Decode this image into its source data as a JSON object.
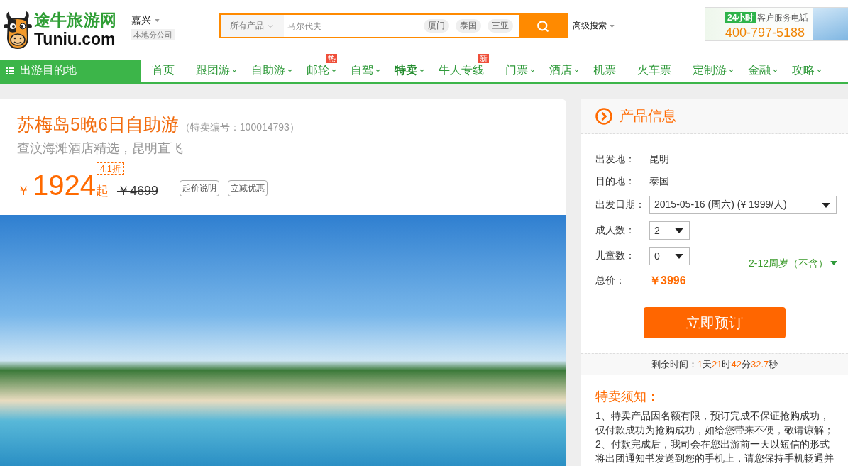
{
  "header": {
    "logo": {
      "title": "途牛旅游网",
      "domain": "Tuniu.com"
    },
    "city": {
      "name": "嘉兴",
      "badge": "本地分公司"
    },
    "search": {
      "category": "所有产品",
      "placeholder": "马尔代夫",
      "tags": [
        "厦门",
        "泰国",
        "三亚"
      ]
    },
    "advanced_search": "高级搜索",
    "hotline": {
      "badge": "24小时",
      "label": "客户服务电话",
      "number": "400-797-5188"
    }
  },
  "nav": {
    "destinations": "出游目的地",
    "items": [
      {
        "label": "首页",
        "dropdown": false,
        "selected": false
      },
      {
        "label": "跟团游",
        "dropdown": true,
        "selected": false
      },
      {
        "label": "自助游",
        "dropdown": true,
        "selected": false
      },
      {
        "label": "邮轮",
        "dropdown": true,
        "selected": false,
        "badge": "热"
      },
      {
        "label": "自驾",
        "dropdown": true,
        "selected": false
      },
      {
        "label": "特卖",
        "dropdown": true,
        "selected": true
      },
      {
        "label": "牛人专线",
        "dropdown": false,
        "selected": false,
        "badge": "新"
      },
      {
        "label": "门票",
        "dropdown": true,
        "selected": false
      },
      {
        "label": "酒店",
        "dropdown": true,
        "selected": false
      },
      {
        "label": "机票",
        "dropdown": false,
        "selected": false
      },
      {
        "label": "火车票",
        "dropdown": false,
        "selected": false
      },
      {
        "label": "定制游",
        "dropdown": true,
        "selected": false
      },
      {
        "label": "金融",
        "dropdown": true,
        "selected": false
      },
      {
        "label": "攻略",
        "dropdown": true,
        "selected": false
      }
    ]
  },
  "product": {
    "title": "苏梅岛5晚6日自助游",
    "code": "（特卖编号：100014793）",
    "subtitle": "查汶海滩酒店精选，昆明直飞",
    "price": {
      "currency": "￥",
      "amount": "1924",
      "suffix": "起",
      "discount": "4.1折",
      "original": "￥4699"
    },
    "buttons": [
      "起价说明",
      "立减优惠"
    ]
  },
  "info_panel": {
    "title": "产品信息",
    "fields": [
      {
        "kind": "text",
        "label": "出发地：",
        "value": "昆明"
      },
      {
        "kind": "text",
        "label": "目的地：",
        "value": "泰国"
      },
      {
        "kind": "date",
        "label": "出发日期：",
        "value": "2015-05-16 (周六) (¥ 1999/人)"
      },
      {
        "kind": "count",
        "label": "成人数：",
        "value": "2"
      },
      {
        "kind": "count",
        "label": "儿童数：",
        "value": "0",
        "note": "2-12周岁（不含）"
      },
      {
        "kind": "price",
        "label": "总价：",
        "value": "￥3996"
      }
    ],
    "book_button": "立即预订",
    "countdown": {
      "label": "剩余时间：",
      "parts": [
        {
          "value": "1",
          "unit": "天"
        },
        {
          "value": "21",
          "unit": "时"
        },
        {
          "value": "42",
          "unit": "分"
        },
        {
          "value": "32.7",
          "unit": "秒"
        }
      ]
    },
    "notice": {
      "title": "特卖须知：",
      "items": [
        "1、特卖产品因名额有限，预订完成不保证抢购成功，仅付款成功为抢购成功，如给您带来不便，敬请谅解；",
        "2、付款完成后，我司会在您出游前一天以短信的形式将出团通知书发送到您的手机上，请您保持手机畅通并"
      ]
    }
  }
}
